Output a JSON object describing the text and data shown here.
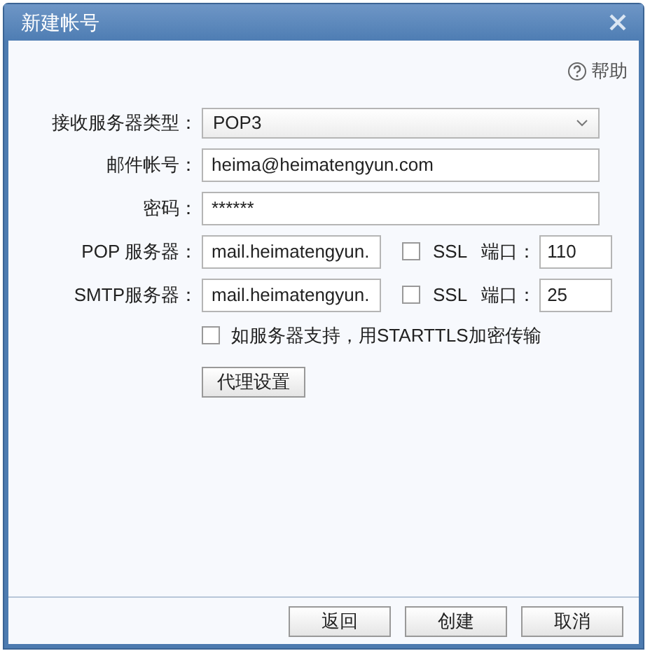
{
  "window": {
    "title": "新建帐号"
  },
  "help": "帮助",
  "fields": [
    {
      "kind": "select",
      "label": "接收服务器类型：",
      "value": "POP3"
    },
    {
      "kind": "text",
      "label": "邮件帐号：",
      "value": "heima@heimatengyun.com"
    },
    {
      "kind": "text",
      "label": "密码：",
      "value": "******"
    },
    {
      "kind": "server",
      "label": "POP 服务器：",
      "value": "mail.heimatengyun.",
      "ssl": {
        "label": "SSL",
        "checked": false
      },
      "port_label": "端口：",
      "port": "110"
    },
    {
      "kind": "server",
      "label": "SMTP服务器：",
      "value": "mail.heimatengyun.",
      "ssl": {
        "label": "SSL",
        "checked": false
      },
      "port_label": "端口：",
      "port": "25"
    }
  ],
  "starttls": {
    "label": "如服务器支持，用STARTTLS加密传输",
    "checked": false
  },
  "proxy_button": "代理设置",
  "buttons": [
    "返回",
    "创建",
    "取消"
  ]
}
